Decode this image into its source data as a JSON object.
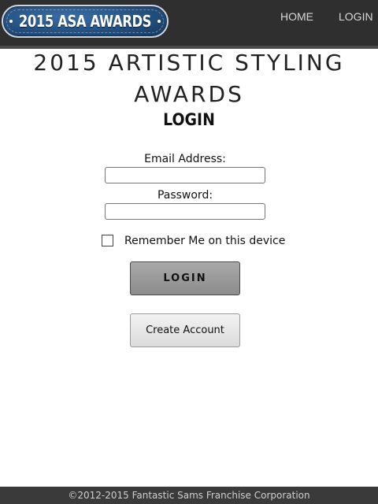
{
  "header": {
    "logo_text": "2015 ASA AWARDS",
    "nav": {
      "home": "HOME",
      "login": "LOGIN"
    }
  },
  "main": {
    "title": "2015 ARTISTIC STYLING AWARDS",
    "subtitle": "LOGIN",
    "email_label": "Email Address:",
    "email_value": "",
    "password_label": "Password:",
    "password_value": "",
    "remember_label": "Remember Me on this device",
    "remember_checked": false,
    "login_button": "LOGIN",
    "create_account_button": "Create Account"
  },
  "footer": {
    "copyright": "©2012-2015 Fantastic Sams Franchise Corporation"
  },
  "colors": {
    "header_bg": "#2f2f2f",
    "logo_blue": "#24507f",
    "login_button_bg": "#9a9a9a",
    "create_button_bg": "#e6e6e6",
    "footer_bg": "#3a3a3a"
  }
}
